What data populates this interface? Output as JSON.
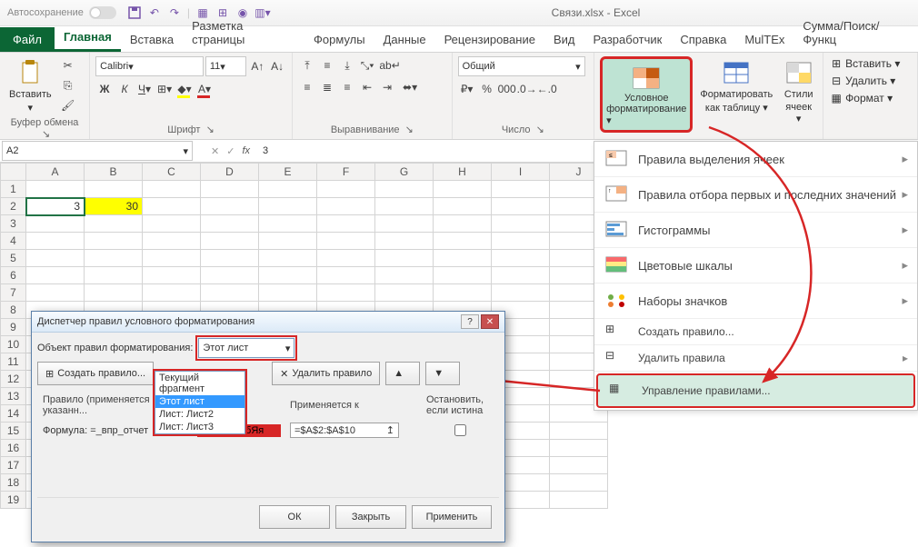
{
  "titlebar": {
    "autosave": "Автосохранение",
    "title": "Связи.xlsx - Excel"
  },
  "tabs": {
    "file": "Файл",
    "home": "Главная",
    "insert": "Вставка",
    "layout": "Разметка страницы",
    "formulas": "Формулы",
    "data": "Данные",
    "review": "Рецензирование",
    "view": "Вид",
    "developer": "Разработчик",
    "help": "Справка",
    "multex": "MulTEx",
    "sum": "Сумма/Поиск/Функц"
  },
  "ribbon": {
    "clipboard": {
      "label": "Буфер обмена",
      "paste": "Вставить"
    },
    "font": {
      "label": "Шрифт",
      "name": "Calibri",
      "size": "11"
    },
    "align": {
      "label": "Выравнивание"
    },
    "number": {
      "label": "Число",
      "format": "Общий"
    },
    "cond": {
      "line1": "Условное",
      "line2": "форматирование ▾"
    },
    "table": {
      "line1": "Форматировать",
      "line2": "как таблицу ▾"
    },
    "styles": {
      "line1": "Стили",
      "line2": "ячеек ▾"
    },
    "cells": {
      "insert": "Вставить ▾",
      "delete": "Удалить ▾",
      "format": "Формат ▾"
    }
  },
  "namebox": {
    "ref": "A2",
    "fx": "fx",
    "value": "3"
  },
  "grid": {
    "cols": [
      "A",
      "B",
      "C",
      "D",
      "E",
      "F",
      "G",
      "H",
      "I",
      "J"
    ],
    "rows": [
      "1",
      "2",
      "3",
      "4",
      "5",
      "6",
      "7",
      "8",
      "9",
      "10",
      "11",
      "12",
      "13",
      "14",
      "15",
      "16",
      "17",
      "18",
      "19"
    ],
    "a2": "3",
    "b2": "30"
  },
  "menu": {
    "highlight": "Правила выделения ячеек",
    "toprules": "Правила отбора первых и последних значений",
    "databars": "Гистограммы",
    "colorscales": "Цветовые шкалы",
    "iconsets": "Наборы значков",
    "newrule": "Создать правило...",
    "clear": "Удалить правила",
    "manage": "Управление правилами..."
  },
  "dialog": {
    "title": "Диспетчер правил условного форматирования",
    "scope_label": "Объект правил форматирования:",
    "scope_value": "Этот лист",
    "scope_options": [
      "Текущий фрагмент",
      "Этот лист",
      "Лист: Лист2",
      "Лист: Лист3"
    ],
    "btn_new": "Создать правило...",
    "btn_del": "Удалить правило",
    "col_rule": "Правило (применяется в указанн...",
    "col_format": "АаВbБбЯя",
    "col_applies": "Применяется к",
    "col_stop": "Остановить, если истина",
    "rule_text": "Формула: =_впр_отчет",
    "applies_value": "=$A$2:$A$10",
    "ok": "ОК",
    "close": "Закрыть",
    "apply": "Применить"
  }
}
